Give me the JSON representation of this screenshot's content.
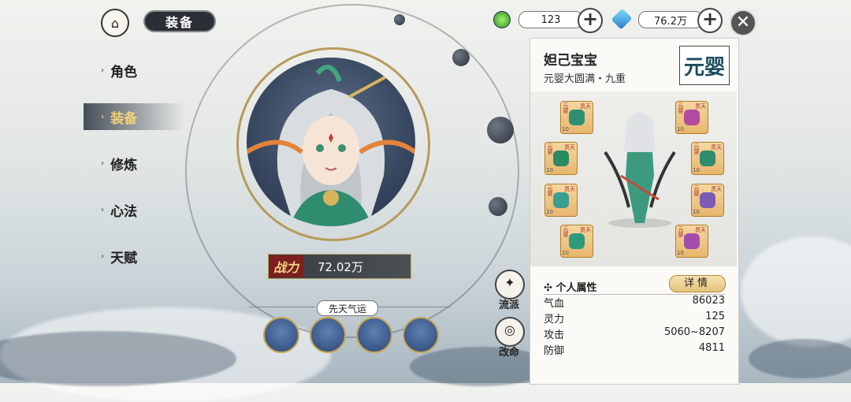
{
  "header": {
    "title": "装备",
    "resource1_value": "123",
    "resource2_value": "76.2万"
  },
  "nav": {
    "items": [
      {
        "label": "角色"
      },
      {
        "label": "装备"
      },
      {
        "label": "修炼"
      },
      {
        "label": "心法"
      },
      {
        "label": "天赋"
      }
    ],
    "active_index": 1
  },
  "portrait": {
    "power_label": "战力",
    "power_value": "72.02万"
  },
  "fate": {
    "label": "先天气运"
  },
  "side_buttons": {
    "faction_label": "流派",
    "destiny_label": "改命"
  },
  "panel": {
    "name": "妲己宝宝",
    "subtitle": "元婴大圆满・九重",
    "realm_badge": "元婴",
    "equip_tag": "元婴",
    "equip_tag2": "贯天",
    "equip_level": "10",
    "attr_title": "个人属性",
    "detail_label": "详情",
    "attributes": [
      {
        "name": "气血",
        "value": "86023"
      },
      {
        "name": "灵力",
        "value": "125"
      },
      {
        "name": "攻击",
        "value": "5060~8207"
      },
      {
        "name": "防御",
        "value": "4811"
      }
    ]
  },
  "colors": {
    "accent_gold": "#f3d27a",
    "panel_bg": "#fbfaf6",
    "power_tag": "#7b1f1f"
  }
}
